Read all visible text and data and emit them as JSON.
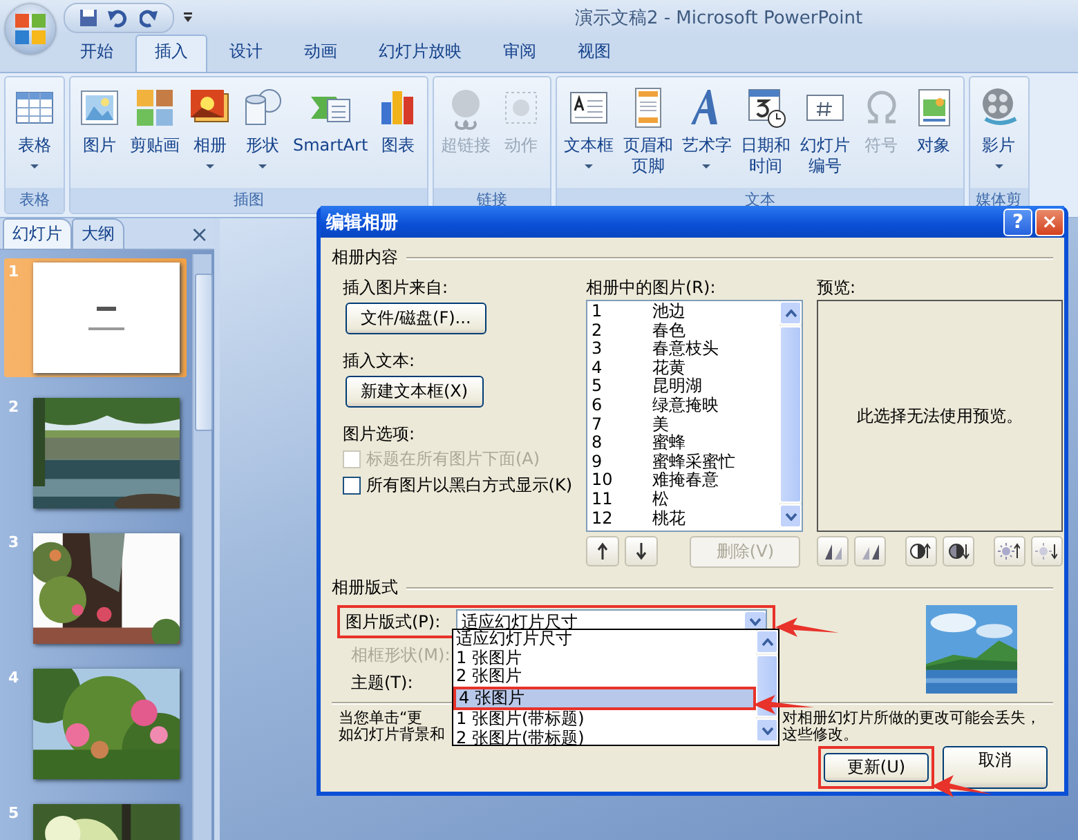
{
  "window": {
    "title": "演示文稿2 - Microsoft PowerPoint"
  },
  "ribbon_tabs": [
    {
      "label": "开始",
      "selected": false
    },
    {
      "label": "插入",
      "selected": true
    },
    {
      "label": "设计",
      "selected": false
    },
    {
      "label": "动画",
      "selected": false
    },
    {
      "label": "幻灯片放映",
      "selected": false
    },
    {
      "label": "审阅",
      "selected": false
    },
    {
      "label": "视图",
      "selected": false
    }
  ],
  "ribbon_groups": [
    {
      "label": "表格",
      "buttons": [
        {
          "label": "表格",
          "dropdown": true,
          "disabled": false
        }
      ]
    },
    {
      "label": "插图",
      "buttons": [
        {
          "label": "图片",
          "dropdown": false,
          "disabled": false
        },
        {
          "label": "剪贴画",
          "dropdown": false,
          "disabled": false
        },
        {
          "label": "相册",
          "dropdown": true,
          "disabled": false
        },
        {
          "label": "形状",
          "dropdown": true,
          "disabled": false
        },
        {
          "label": "SmartArt",
          "dropdown": false,
          "disabled": false
        },
        {
          "label": "图表",
          "dropdown": false,
          "disabled": false
        }
      ]
    },
    {
      "label": "链接",
      "buttons": [
        {
          "label": "超链接",
          "dropdown": false,
          "disabled": true
        },
        {
          "label": "动作",
          "dropdown": false,
          "disabled": true
        }
      ]
    },
    {
      "label": "文本",
      "buttons": [
        {
          "label": "文本框",
          "dropdown": true,
          "disabled": false
        },
        {
          "label": "页眉和页脚",
          "dropdown": false,
          "disabled": false
        },
        {
          "label": "艺术字",
          "dropdown": true,
          "disabled": false
        },
        {
          "label": "日期和时间",
          "dropdown": false,
          "disabled": false
        },
        {
          "label": "幻灯片编号",
          "dropdown": false,
          "disabled": false
        },
        {
          "label": "符号",
          "dropdown": false,
          "disabled": true
        },
        {
          "label": "对象",
          "dropdown": false,
          "disabled": false
        }
      ]
    },
    {
      "label": "媒体剪",
      "buttons": [
        {
          "label": "影片",
          "dropdown": true,
          "disabled": false
        }
      ]
    }
  ],
  "slide_pane": {
    "tabs": [
      {
        "label": "幻灯片",
        "selected": true
      },
      {
        "label": "大纲",
        "selected": false
      }
    ],
    "close": "×",
    "slides": [
      {
        "number": "1",
        "kind": "title",
        "selected": true
      },
      {
        "number": "2",
        "kind": "picture",
        "selected": false
      },
      {
        "number": "3",
        "kind": "picture",
        "selected": false
      },
      {
        "number": "4",
        "kind": "picture",
        "selected": false
      },
      {
        "number": "5",
        "kind": "picture",
        "selected": false
      }
    ]
  },
  "dialog": {
    "title": "编辑相册",
    "help": "?",
    "close": "×",
    "content_section": "相册内容",
    "insert_picture_label": "插入图片来自:",
    "file_button": "文件/磁盘(F)...",
    "insert_text_label": "插入文本:",
    "textbox_button": "新建文本框(X)",
    "options_label": "图片选项:",
    "options": [
      {
        "label": "标题在所有图片下面(A)",
        "checked": false,
        "disabled": true
      },
      {
        "label": "所有图片以黑白方式显示(K)",
        "checked": false,
        "disabled": false
      }
    ],
    "pictures_label": "相册中的图片(R):",
    "pictures": [
      {
        "number": "1",
        "name": "池边"
      },
      {
        "number": "2",
        "name": "春色"
      },
      {
        "number": "3",
        "name": "春意枝头"
      },
      {
        "number": "4",
        "name": "花黄"
      },
      {
        "number": "5",
        "name": "昆明湖"
      },
      {
        "number": "6",
        "name": "绿意掩映"
      },
      {
        "number": "7",
        "name": "美"
      },
      {
        "number": "8",
        "name": "蜜蜂"
      },
      {
        "number": "9",
        "name": "蜜蜂采蜜忙"
      },
      {
        "number": "10",
        "name": "难掩春意"
      },
      {
        "number": "11",
        "name": "松"
      },
      {
        "number": "12",
        "name": "桃花"
      }
    ],
    "remove_button": {
      "label": "删除(V)",
      "disabled": true
    },
    "preview_label": "预览:",
    "preview_message": "此选择无法使用预览。",
    "layout_section": "相册版式",
    "layout_label": "图片版式(P):",
    "layout_value": "适应幻灯片尺寸",
    "frame_label": {
      "label": "相框形状(M):",
      "disabled": true
    },
    "theme_label": "主题(T):",
    "layout_options": [
      {
        "label": "适应幻灯片尺寸",
        "selected": false
      },
      {
        "label": "1 张图片",
        "selected": false
      },
      {
        "label": "2 张图片",
        "selected": false
      },
      {
        "label": "4 张图片",
        "selected": true
      },
      {
        "label": "1 张图片(带标题)",
        "selected": false
      },
      {
        "label": "2 张图片(带标题)",
        "selected": false
      }
    ],
    "notice": {
      "left": [
        "当您单击“更",
        "如幻灯片背景和"
      ],
      "right": [
        "对相册幻灯片所做的更改可能会丢失，",
        "这些修改。"
      ]
    },
    "buttons": [
      {
        "label": "更新(U)",
        "highlighted": true
      },
      {
        "label": "取消",
        "highlighted": false
      }
    ]
  }
}
